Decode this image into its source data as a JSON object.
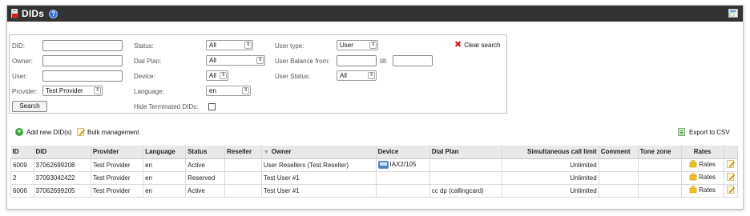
{
  "header": {
    "title": "DIDs",
    "help_icon": "help-icon",
    "window_icon": "window-restore-icon"
  },
  "search": {
    "did_label": "DID:",
    "owner_label": "Owner:",
    "user_label": "User:",
    "provider_label": "Provider:",
    "provider_value": "Test Provider",
    "search_button": "Search",
    "status_label": "Status:",
    "status_value": "All",
    "dial_plan_label": "Dial Plan:",
    "dial_plan_value": "All",
    "device_label": "Device:",
    "device_value": "All",
    "language_label": "Language:",
    "language_value": "en",
    "hide_terminated_label": "Hide Terminated DIDs:",
    "user_type_label": "User type:",
    "user_type_value": "User",
    "user_balance_from_label": "User Balance from:",
    "till_label": "till:",
    "user_status_label": "User Status:",
    "user_status_value": "All",
    "clear_search": "Clear search"
  },
  "actions": {
    "add_new": "Add new DID(s)",
    "bulk": "Bulk management",
    "export_csv": "Export to CSV"
  },
  "table": {
    "columns": {
      "id": "ID",
      "did": "DID",
      "provider": "Provider",
      "language": "Language",
      "status": "Status",
      "reseller": "Reseller",
      "owner": "Owner",
      "device": "Device",
      "dial_plan": "Dial Plan",
      "sim_limit": "Simultaneous call limit",
      "comment": "Comment",
      "tone_zone": "Tone zone",
      "rates": "Rates"
    },
    "rows": [
      {
        "id": "6009",
        "did": "37062699208",
        "provider": "Test Provider",
        "language": "en",
        "status": "Active",
        "reseller": "",
        "owner": "User Resellers (Test Reseller)",
        "device": "IAX2/105",
        "dial_plan": "",
        "sim_limit": "Unlimited",
        "comment": "",
        "tone_zone": "",
        "rates": "Rates"
      },
      {
        "id": "2",
        "did": "37093042422",
        "provider": "Test Provider",
        "language": "en",
        "status": "Reserved",
        "reseller": "",
        "owner": "Test User #1",
        "device": "",
        "dial_plan": "",
        "sim_limit": "Unlimited",
        "comment": "",
        "tone_zone": "",
        "rates": "Rates"
      },
      {
        "id": "6006",
        "did": "37062699205",
        "provider": "Test Provider",
        "language": "en",
        "status": "Active",
        "reseller": "",
        "owner": "Test User #1",
        "device": "",
        "dial_plan": "cc dp (callingcard)",
        "sim_limit": "Unlimited",
        "comment": "",
        "tone_zone": "",
        "rates": "Rates"
      }
    ]
  },
  "colors": {
    "titlebar": "#333333",
    "header_row": "#e9e9e9",
    "clear_x": "#d61a1a",
    "add_green": "#3aa63a"
  }
}
